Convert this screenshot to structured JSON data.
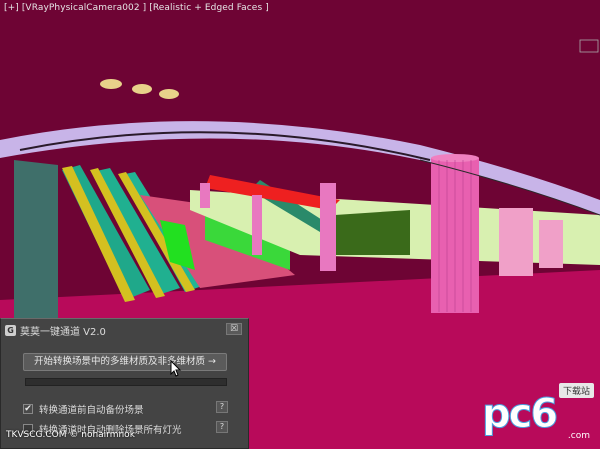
{
  "viewport": {
    "label": "[+] [VRayPhysicalCamera002 ] [Realistic + Edged Faces ]"
  },
  "panel": {
    "title": "莫莫一键通道 V2.0",
    "close_label": "☒",
    "convert_button": "开始转换场景中的多维材质及非多维材质 →",
    "progress": 0,
    "options": [
      {
        "label": "转换通道前自动备份场景",
        "checked": true,
        "help": "?"
      },
      {
        "label": "转换通道时自动删除场景所有灯光",
        "checked": false,
        "help": "?"
      }
    ]
  },
  "watermark": "TKVSCG.COM © nohairmnok",
  "logo": {
    "brand": "pc6",
    "badge": "下载站",
    "site": ".com"
  }
}
